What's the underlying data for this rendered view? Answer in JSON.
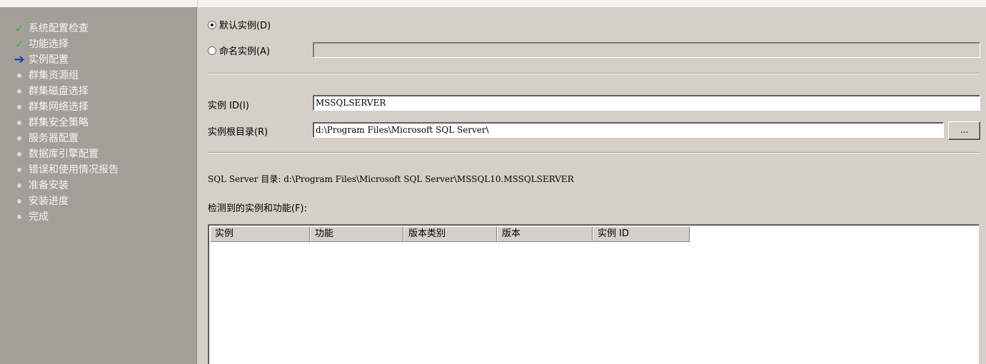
{
  "sidebar": {
    "items": [
      {
        "label": "系统配置检查",
        "state": "done"
      },
      {
        "label": "功能选择",
        "state": "done"
      },
      {
        "label": "实例配置",
        "state": "current"
      },
      {
        "label": "群集资源组",
        "state": "pending"
      },
      {
        "label": "群集磁盘选择",
        "state": "pending"
      },
      {
        "label": "群集网络选择",
        "state": "pending"
      },
      {
        "label": "群集安全策略",
        "state": "pending"
      },
      {
        "label": "服务器配置",
        "state": "pending"
      },
      {
        "label": "数据库引擎配置",
        "state": "pending"
      },
      {
        "label": "错误和使用情况报告",
        "state": "pending"
      },
      {
        "label": "准备安装",
        "state": "pending"
      },
      {
        "label": "安装进度",
        "state": "pending"
      },
      {
        "label": "完成",
        "state": "pending"
      }
    ]
  },
  "instance": {
    "default_label": "默认实例(D)",
    "default_selected": true,
    "named_label": "命名实例(A)",
    "named_value": "",
    "id_label": "实例 ID(I)",
    "id_value": "MSSQLSERVER",
    "root_label": "实例根目录(R)",
    "root_value": "d:\\Program Files\\Microsoft SQL Server\\",
    "browse_label": "...",
    "sql_dir_label": "SQL Server 目录:",
    "sql_dir_value": "d:\\Program Files\\Microsoft SQL Server\\MSSQL10.MSSQLSERVER",
    "detected_label": "检测到的实例和功能(F):"
  },
  "table": {
    "columns": [
      "实例",
      "功能",
      "版本类别",
      "版本",
      "实例 ID"
    ],
    "rows": []
  },
  "colors": {
    "sidebar_bg": "#a29f99",
    "panel_bg": "#d4d0c8",
    "check": "#3fae2a",
    "arrow": "#1a3fa8"
  }
}
